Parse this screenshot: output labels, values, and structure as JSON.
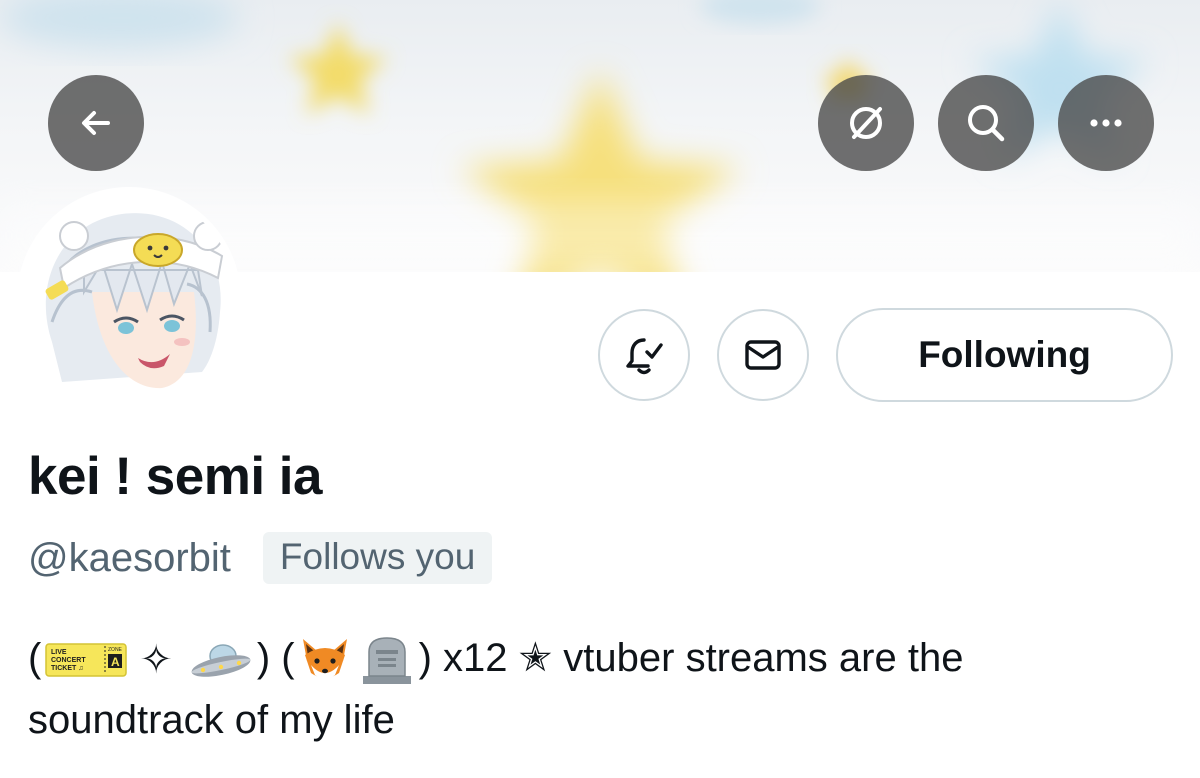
{
  "header": {
    "back_icon": "arrow-left-icon",
    "grok_icon": "slashed-circle-icon",
    "search_icon": "search-icon",
    "more_icon": "more-horizontal-icon"
  },
  "banner": {
    "palette": {
      "star_yellow": "#f6e27a",
      "star_blue": "#bfe0f0",
      "background": "#eef1f4"
    }
  },
  "profile": {
    "display_name": "kei ! semi ia",
    "handle": "@kaesorbit",
    "follows_you": "Follows you",
    "following_label": "Following",
    "notifications_icon": "bell-check-icon",
    "message_icon": "mail-icon",
    "bio": {
      "ticket_emoji": {
        "icon": "ticket-emoji",
        "line1": "LIVE",
        "line2": "CONCERT",
        "line3": "TICKET ♫",
        "zone_label": "ZONE",
        "zone": "A"
      },
      "segment_open1": "(",
      "sparkle": "✧",
      "ufo_emoji": "ufo-emoji",
      "segment_close1": ")",
      "segment_open2": " (",
      "fox_emoji": "fox-emoji",
      "headstone_emoji": "headstone-emoji",
      "segment_tail": ") x12 ✭ vtuber streams are the",
      "line2": "soundtrack of my life"
    }
  },
  "colors": {
    "text_primary": "#0f1419",
    "text_secondary": "#536471",
    "border": "#cfd9de",
    "badge_bg": "#eff3f4"
  }
}
